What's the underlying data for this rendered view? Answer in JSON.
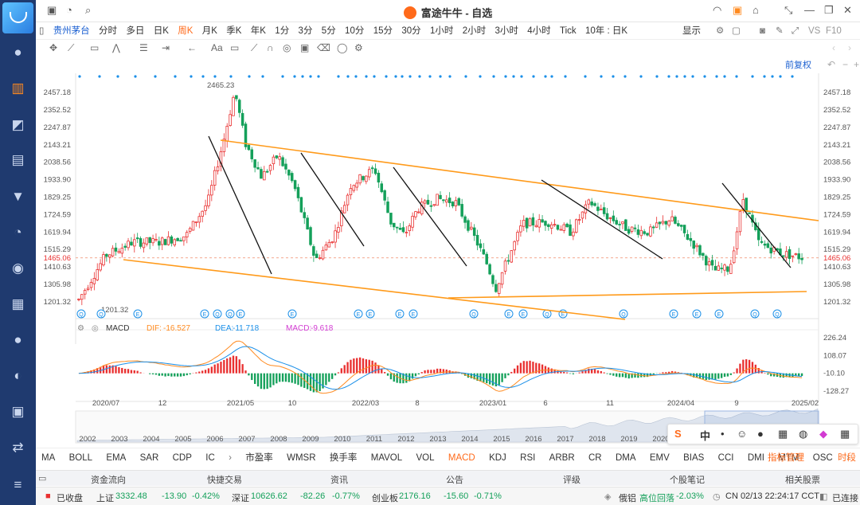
{
  "window": {
    "title": "富途牛牛 - 自选"
  },
  "sidebar": {
    "items": [
      "user-icon",
      "chart-bar-icon",
      "trend-icon",
      "portfolio-icon",
      "filter-icon",
      "pie-icon",
      "zigzag-icon",
      "news-icon",
      "chat-icon",
      "clock-icon",
      "game-icon",
      "swap-icon",
      "menu-icon"
    ]
  },
  "periods": {
    "stock": "贵州茅台",
    "items": [
      "分时",
      "多日",
      "日K",
      "周K",
      "月K",
      "季K",
      "年K",
      "1分",
      "3分",
      "5分",
      "10分",
      "15分",
      "30分",
      "1小时",
      "2小时",
      "3小时",
      "4小时",
      "Tick",
      "10年 : 日K"
    ],
    "active": "周K",
    "display": "显示",
    "vs": "VS",
    "f10": "F10"
  },
  "adjust": "前复权",
  "chart_data": {
    "type": "candlestick",
    "price_axis_ticks": [
      "2457.18",
      "2352.52",
      "2247.87",
      "2143.21",
      "2038.56",
      "1933.90",
      "1829.25",
      "1724.59",
      "1619.94",
      "1515.29",
      "1410.63",
      "1305.98",
      "1201.32"
    ],
    "current_price_label": "1465.06",
    "max_label": "2465.23",
    "min_label": "1201.32",
    "x_axis_labels": [
      "2020/07",
      "12",
      "2021/05",
      "10",
      "2022/03",
      "8",
      "2023/01",
      "6",
      "11",
      "2024/04",
      "9",
      "2025/02"
    ],
    "overview_years": [
      "2002",
      "2003",
      "2004",
      "2005",
      "2006",
      "2007",
      "2008",
      "2009",
      "2010",
      "2011",
      "2012",
      "2013",
      "2014",
      "2015",
      "2016",
      "2017",
      "2018",
      "2019",
      "2020"
    ],
    "macd": {
      "name": "MACD",
      "dif_label": "DIF:",
      "dif": "-16.527",
      "dea_label": "DEA:",
      "dea": "-11.718",
      "macd_label": "MACD:",
      "macd": "-9.618",
      "axis_ticks": [
        "226.24",
        "108.07",
        "-10.10",
        "-128.27"
      ]
    }
  },
  "indicators": {
    "items": [
      "MA",
      "BOLL",
      "EMA",
      "SAR",
      "CDP",
      "IC",
      "市盈率",
      "WMSR",
      "换手率",
      "MAVOL",
      "VOL",
      "MACD",
      "KDJ",
      "RSI",
      "ARBR",
      "CR",
      "DMA",
      "EMV",
      "BIAS",
      "CCI",
      "DMI",
      "MTM",
      "OSC"
    ],
    "active": "MACD",
    "manage": "指标管理",
    "time": "时段"
  },
  "inforow": {
    "items": [
      "资金流向",
      "快捷交易",
      "资讯",
      "公告",
      "评级",
      "个股笔记",
      "相关股票"
    ]
  },
  "status": {
    "market": "已收盘",
    "sh": {
      "name": "上证",
      "value": "3332.48",
      "chg": "-13.90",
      "pct": "-0.42%"
    },
    "sz": {
      "name": "深证",
      "value": "10626.62",
      "chg": "-82.26",
      "pct": "-0.77%"
    },
    "cy": {
      "name": "创业板",
      "value": "2176.16",
      "chg": "-15.60",
      "pct": "-0.71%"
    },
    "alert_name": "俄铝",
    "alert_text": "高位回落",
    "alert_pct": "-2.03%",
    "time": "CN 02/13 22:24:17 CCT",
    "conn": "已连接"
  },
  "toolbox": {
    "input": "中"
  }
}
